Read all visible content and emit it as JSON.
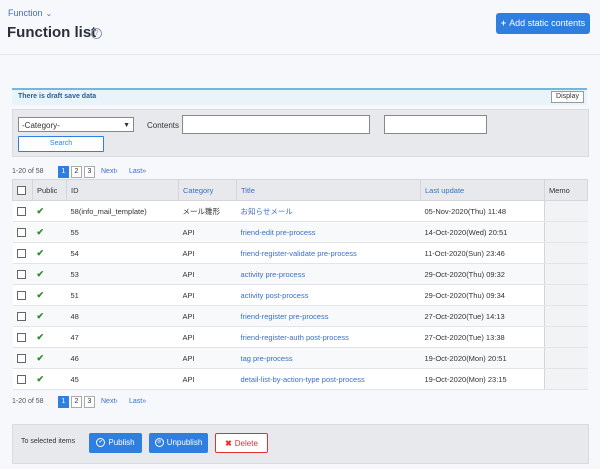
{
  "header": {
    "breadcrumb": "Function",
    "title": "Function list",
    "help_icon": "?",
    "add_button_icon": "+",
    "add_button": "Add static contents"
  },
  "draft": {
    "notice": "There is draft save data",
    "display_button": "Display"
  },
  "filter": {
    "category_selected": "-Category-",
    "contents_label": "Contents",
    "contents_value": "",
    "search_button": "Search"
  },
  "pager": {
    "count": "1-20 of 58",
    "pages": [
      "1",
      "2",
      "3"
    ],
    "next": "Next",
    "last": "Last"
  },
  "table": {
    "columns": [
      "Public",
      "ID",
      "Category",
      "Title",
      "Last update",
      "Memo"
    ],
    "rows": [
      {
        "id": "58(info_mail_template)",
        "category": "メール雛形",
        "title": "お知らせメール",
        "updated": "05-Nov-2020(Thu) 11:48"
      },
      {
        "id": "55",
        "category": "API",
        "title": "friend-edit pre-process",
        "updated": "14-Oct-2020(Wed) 20:51"
      },
      {
        "id": "54",
        "category": "API",
        "title": "friend-register-validate pre-process",
        "updated": "11-Oct-2020(Sun) 23:46"
      },
      {
        "id": "53",
        "category": "API",
        "title": "activity pre-process",
        "updated": "29-Oct-2020(Thu) 09:32"
      },
      {
        "id": "51",
        "category": "API",
        "title": "activity post-process",
        "updated": "29-Oct-2020(Thu) 09:34"
      },
      {
        "id": "48",
        "category": "API",
        "title": "friend-register pre-process",
        "updated": "27-Oct-2020(Tue) 14:13"
      },
      {
        "id": "47",
        "category": "API",
        "title": "friend-register-auth post-process",
        "updated": "27-Oct-2020(Tue) 13:38"
      },
      {
        "id": "46",
        "category": "API",
        "title": "tag pre-process",
        "updated": "19-Oct-2020(Mon) 20:51"
      },
      {
        "id": "45",
        "category": "API",
        "title": "detail-list-by-action-type post-process",
        "updated": "19-Oct-2020(Mon) 23:15"
      }
    ]
  },
  "bulk": {
    "label": "To selected items",
    "publish": "Publish",
    "unpublish": "Unpublish",
    "delete": "Delete"
  },
  "colors": {
    "accent": "#2f7fe0",
    "link": "#3a6fc4",
    "public_check": "#2e8b2e",
    "delete": "#dd3333"
  }
}
